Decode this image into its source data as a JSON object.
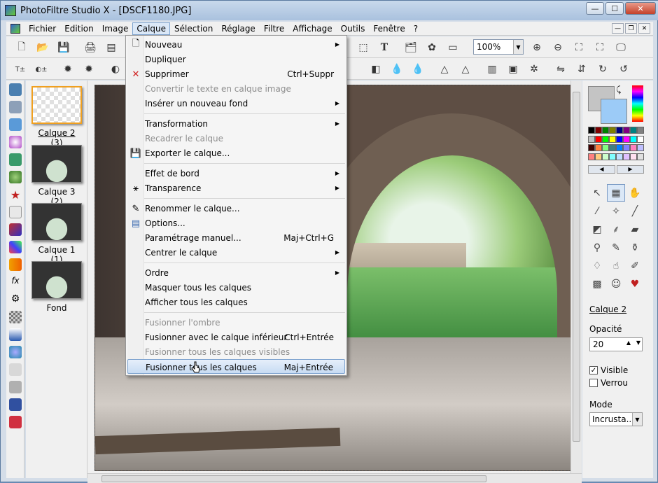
{
  "window": {
    "title": "PhotoFiltre Studio X - [DSCF1180.JPG]",
    "min": "—",
    "max": "☐",
    "close": "✕"
  },
  "menubar": {
    "items": [
      "Fichier",
      "Edition",
      "Image",
      "Calque",
      "Sélection",
      "Réglage",
      "Filtre",
      "Affichage",
      "Outils",
      "Fenêtre",
      "?"
    ],
    "active": "Calque"
  },
  "toolbar": {
    "zoom": "100%"
  },
  "layers": [
    {
      "label": "Calque 2 (3)",
      "selected": true
    },
    {
      "label": "Calque 3 (2)"
    },
    {
      "label": "Calque 1 (1)"
    },
    {
      "label": "Fond"
    }
  ],
  "dropdown": {
    "items": [
      {
        "label": "Nouveau",
        "icon": "new-page-icon",
        "submenu": true
      },
      {
        "label": "Dupliquer"
      },
      {
        "label": "Supprimer",
        "icon": "red-x-icon",
        "shortcut": "Ctrl+Suppr"
      },
      {
        "label": "Convertir le texte en calque image",
        "disabled": true
      },
      {
        "label": "Insérer un nouveau fond",
        "submenu": true
      },
      {
        "label": "Transformation",
        "submenu": true
      },
      {
        "label": "Recadrer le calque",
        "disabled": true
      },
      {
        "label": "Exporter le calque...",
        "icon": "floppy-icon"
      },
      {
        "label": "Effet de bord",
        "submenu": true
      },
      {
        "label": "Transparence",
        "icon": "transparency-icon",
        "submenu": true
      },
      {
        "label": "Renommer le calque...",
        "icon": "rename-icon"
      },
      {
        "label": "Options...",
        "icon": "options-icon"
      },
      {
        "label": "Paramétrage manuel...",
        "shortcut": "Maj+Ctrl+G"
      },
      {
        "label": "Centrer le calque",
        "submenu": true
      },
      {
        "label": "Ordre",
        "submenu": true
      },
      {
        "label": "Masquer tous les calques"
      },
      {
        "label": "Afficher tous les calques"
      },
      {
        "label": "Fusionner l'ombre",
        "disabled": true
      },
      {
        "label": "Fusionner avec le calque inférieur",
        "shortcut": "Ctrl+Entrée"
      },
      {
        "label": "Fusionner tous les calques visibles",
        "disabled": true
      },
      {
        "label": "Fusionner tous les calques",
        "shortcut": "Maj+Entrée",
        "highlighted": true
      }
    ]
  },
  "rightpanel": {
    "layer_name": "Calque 2",
    "opacity_label": "Opacité",
    "opacity_value": "20",
    "visible_label": "Visible",
    "visible_checked": true,
    "lock_label": "Verrou",
    "lock_checked": false,
    "mode_label": "Mode",
    "mode_value": "Incrusta..."
  },
  "colors": {
    "foreground": "#c4c4c4",
    "background": "#9ccbf7",
    "highlight": "#c7dcf3"
  }
}
